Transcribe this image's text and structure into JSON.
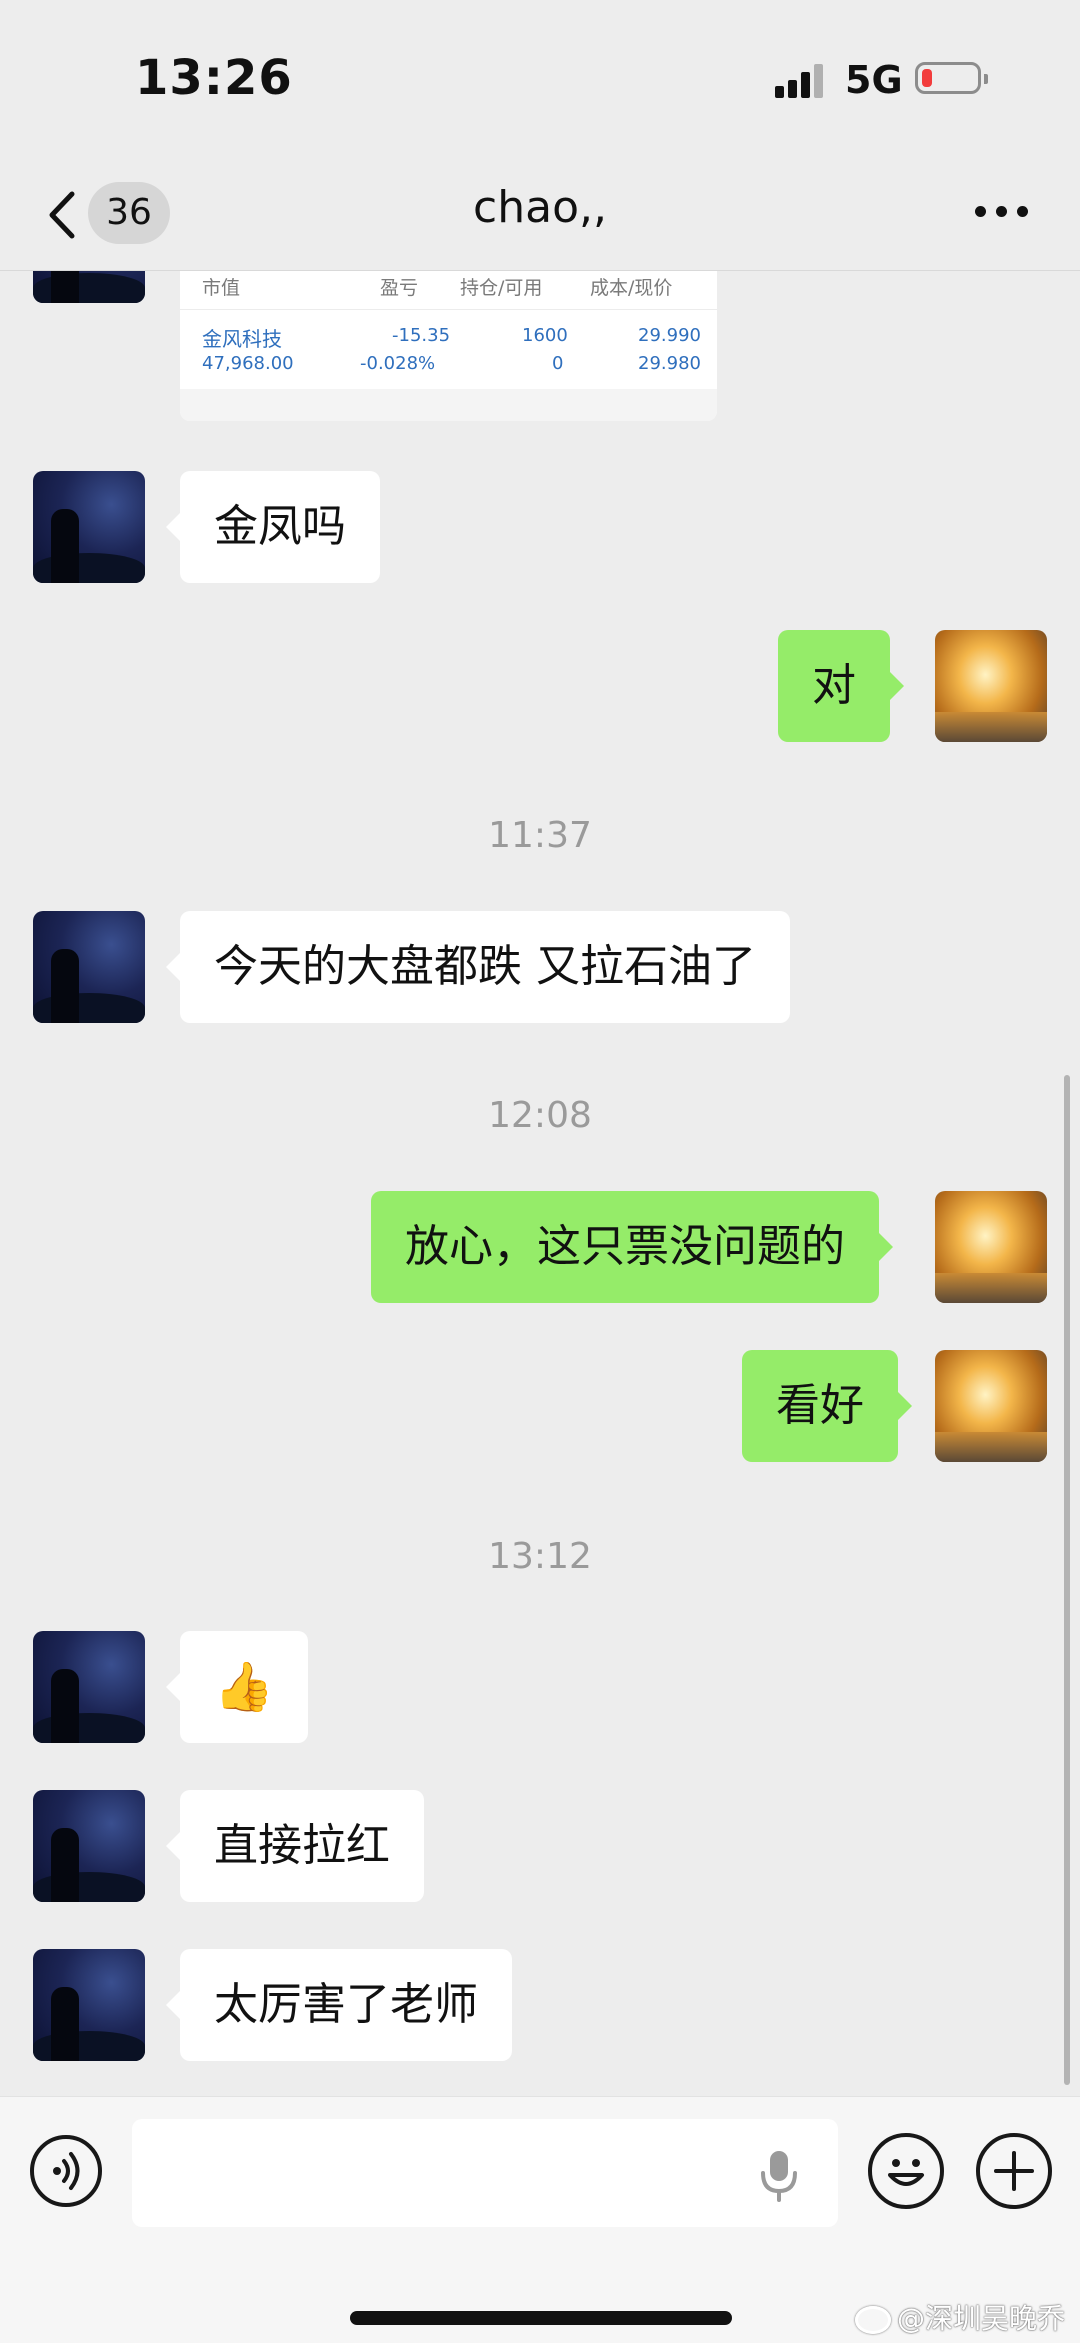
{
  "status_bar": {
    "time": "13:26",
    "network": "5G",
    "battery_level": 0.1,
    "battery_color": "#f23c3c"
  },
  "header": {
    "unread_count": "36",
    "title": "chao,,"
  },
  "stock_card": {
    "columns": [
      "市值",
      "盈亏",
      "持仓/可用",
      "成本/现价"
    ],
    "row": {
      "name": "金风科技",
      "market_value": "47,968.00",
      "pnl": "-15.35",
      "pnl_pct": "-0.028%",
      "position": "1600",
      "available": "0",
      "cost": "29.990",
      "price": "29.980"
    }
  },
  "messages": [
    {
      "side": "left",
      "text": "金凤吗"
    },
    {
      "side": "right",
      "text": "对"
    },
    {
      "type": "time",
      "text": "11:37"
    },
    {
      "side": "left",
      "text": "今天的大盘都跌 又拉石油了"
    },
    {
      "type": "time",
      "text": "12:08"
    },
    {
      "side": "right",
      "text": "放心，这只票没问题的"
    },
    {
      "side": "right",
      "text": "看好"
    },
    {
      "type": "time",
      "text": "13:12"
    },
    {
      "side": "left",
      "text": "👍"
    },
    {
      "side": "left",
      "text": "直接拉红"
    },
    {
      "side": "left",
      "text": "太厉害了老师"
    }
  ],
  "colors": {
    "bubble_self": "#95ec69",
    "bubble_other": "#ffffff",
    "background": "#ededed",
    "stock_text": "#2f6fbd"
  },
  "input_bar": {
    "placeholder": ""
  },
  "watermark": "@深圳吴晚乔"
}
